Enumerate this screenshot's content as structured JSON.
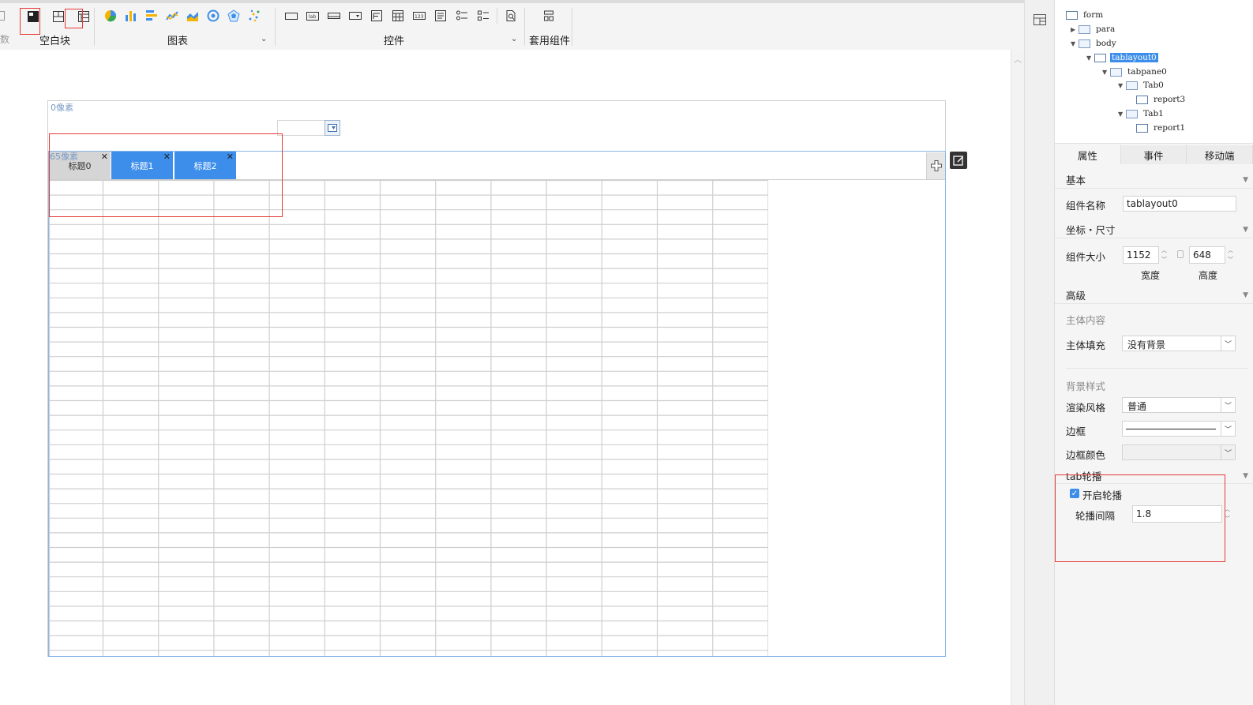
{
  "toolbar": {
    "left_edge_text": "数",
    "groups": [
      {
        "label": "空白块"
      },
      {
        "label": "图表"
      },
      {
        "label": "控件"
      },
      {
        "label": "套用组件"
      }
    ],
    "highlight_color": "#e53935"
  },
  "canvas": {
    "px_label_top": "0像素",
    "px_label_tab": "65像素",
    "tabs": [
      {
        "label": "标题0",
        "state": "inactive"
      },
      {
        "label": "标题1",
        "state": "active"
      },
      {
        "label": "标题2",
        "state": "active"
      }
    ],
    "grid": {
      "columns": 13,
      "rows": 33
    },
    "accent": "#3d8eea"
  },
  "tree": {
    "nodes": [
      {
        "label": "form",
        "level": 0
      },
      {
        "label": "para",
        "level": 1,
        "toggle": "collapsed"
      },
      {
        "label": "body",
        "level": 1,
        "toggle": "expanded"
      },
      {
        "label": "tablayout0",
        "level": 2,
        "toggle": "expanded",
        "selected": true
      },
      {
        "label": "tabpane0",
        "level": 3,
        "toggle": "expanded"
      },
      {
        "label": "Tab0",
        "level": 4,
        "toggle": "expanded"
      },
      {
        "label": "report3",
        "level": 5
      },
      {
        "label": "Tab1",
        "level": 4,
        "toggle": "expanded"
      },
      {
        "label": "report1",
        "level": 5
      }
    ]
  },
  "panel": {
    "tabs": [
      "属性",
      "事件",
      "移动端"
    ],
    "active_tab": "属性",
    "basic": {
      "header": "基本",
      "name_label": "组件名称",
      "name_value": "tablayout0"
    },
    "geometry": {
      "header": "坐标・尺寸",
      "size_label": "组件大小",
      "width_value": "1152",
      "height_value": "648",
      "width_caption": "宽度",
      "height_caption": "高度"
    },
    "advanced": {
      "header": "高级",
      "body_content": "主体内容",
      "body_fill_label": "主体填充",
      "body_fill_value": "没有背景",
      "bg_style": "背景样式",
      "render_style_label": "渲染风格",
      "render_style_value": "普通",
      "border_label": "边框",
      "border_color_label": "边框颜色"
    },
    "carousel": {
      "header": "tab轮播",
      "enable_label": "开启轮播",
      "enabled": true,
      "interval_label": "轮播间隔",
      "interval_value": "1.8"
    }
  }
}
